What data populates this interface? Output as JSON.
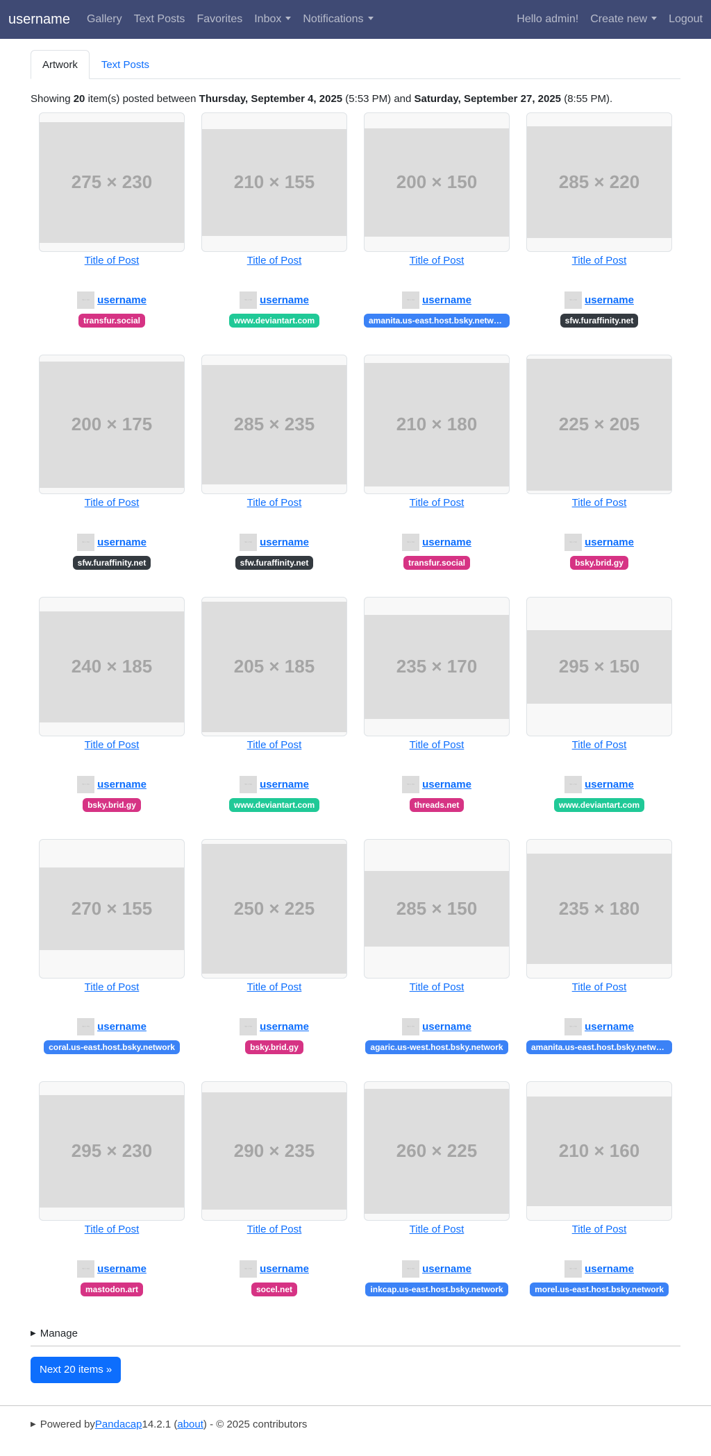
{
  "navbar": {
    "brand": "username",
    "links": [
      "Gallery",
      "Text Posts",
      "Favorites"
    ],
    "inbox": "Inbox",
    "notifications": "Notifications",
    "greeting": "Hello admin!",
    "create": "Create new",
    "logout": "Logout"
  },
  "tabs": {
    "artwork": "Artwork",
    "text_posts": "Text Posts"
  },
  "showing": {
    "prefix": "Showing ",
    "count": "20",
    "mid1": " item(s) posted between ",
    "start_date": "Thursday, September 4, 2025",
    "start_time": " (5:53 PM) and ",
    "end_date": "Saturday, September 27, 2025",
    "end_time": " (8:55 PM)."
  },
  "colors": {
    "pink": "#d63384",
    "green": "#20c997",
    "blue": "#3b82f6",
    "dark": "#343a40"
  },
  "posts": [
    {
      "w": 275,
      "h": 230,
      "title": "Title of Post",
      "user": "username",
      "site": "transfur.social",
      "color": "pink"
    },
    {
      "w": 210,
      "h": 155,
      "title": "Title of Post",
      "user": "username",
      "site": "www.deviantart.com",
      "color": "green"
    },
    {
      "w": 200,
      "h": 150,
      "title": "Title of Post",
      "user": "username",
      "site": "amanita.us-east.host.bsky.network",
      "color": "blue"
    },
    {
      "w": 285,
      "h": 220,
      "title": "Title of Post",
      "user": "username",
      "site": "sfw.furaffinity.net",
      "color": "dark"
    },
    {
      "w": 200,
      "h": 175,
      "title": "Title of Post",
      "user": "username",
      "site": "sfw.furaffinity.net",
      "color": "dark"
    },
    {
      "w": 285,
      "h": 235,
      "title": "Title of Post",
      "user": "username",
      "site": "sfw.furaffinity.net",
      "color": "dark"
    },
    {
      "w": 210,
      "h": 180,
      "title": "Title of Post",
      "user": "username",
      "site": "transfur.social",
      "color": "pink"
    },
    {
      "w": 225,
      "h": 205,
      "title": "Title of Post",
      "user": "username",
      "site": "bsky.brid.gy",
      "color": "pink"
    },
    {
      "w": 240,
      "h": 185,
      "title": "Title of Post",
      "user": "username",
      "site": "bsky.brid.gy",
      "color": "pink"
    },
    {
      "w": 205,
      "h": 185,
      "title": "Title of Post",
      "user": "username",
      "site": "www.deviantart.com",
      "color": "green"
    },
    {
      "w": 235,
      "h": 170,
      "title": "Title of Post",
      "user": "username",
      "site": "threads.net",
      "color": "pink"
    },
    {
      "w": 295,
      "h": 150,
      "title": "Title of Post",
      "user": "username",
      "site": "www.deviantart.com",
      "color": "green"
    },
    {
      "w": 270,
      "h": 155,
      "title": "Title of Post",
      "user": "username",
      "site": "coral.us-east.host.bsky.network",
      "color": "blue"
    },
    {
      "w": 250,
      "h": 225,
      "title": "Title of Post",
      "user": "username",
      "site": "bsky.brid.gy",
      "color": "pink"
    },
    {
      "w": 285,
      "h": 150,
      "title": "Title of Post",
      "user": "username",
      "site": "agaric.us-west.host.bsky.network",
      "color": "blue"
    },
    {
      "w": 235,
      "h": 180,
      "title": "Title of Post",
      "user": "username",
      "site": "amanita.us-east.host.bsky.network",
      "color": "blue"
    },
    {
      "w": 295,
      "h": 230,
      "title": "Title of Post",
      "user": "username",
      "site": "mastodon.art",
      "color": "pink"
    },
    {
      "w": 290,
      "h": 235,
      "title": "Title of Post",
      "user": "username",
      "site": "socel.net",
      "color": "pink"
    },
    {
      "w": 260,
      "h": 225,
      "title": "Title of Post",
      "user": "username",
      "site": "inkcap.us-east.host.bsky.network",
      "color": "blue"
    },
    {
      "w": 210,
      "h": 160,
      "title": "Title of Post",
      "user": "username",
      "site": "morel.us-east.host.bsky.network",
      "color": "blue"
    }
  ],
  "manage": "Manage",
  "next_button": "Next 20 items »",
  "footer": {
    "prefix": "Powered by ",
    "app": "Pandacap",
    "version": " 14.2.1 (",
    "about": "about",
    "suffix": ") - © 2025 contributors"
  }
}
